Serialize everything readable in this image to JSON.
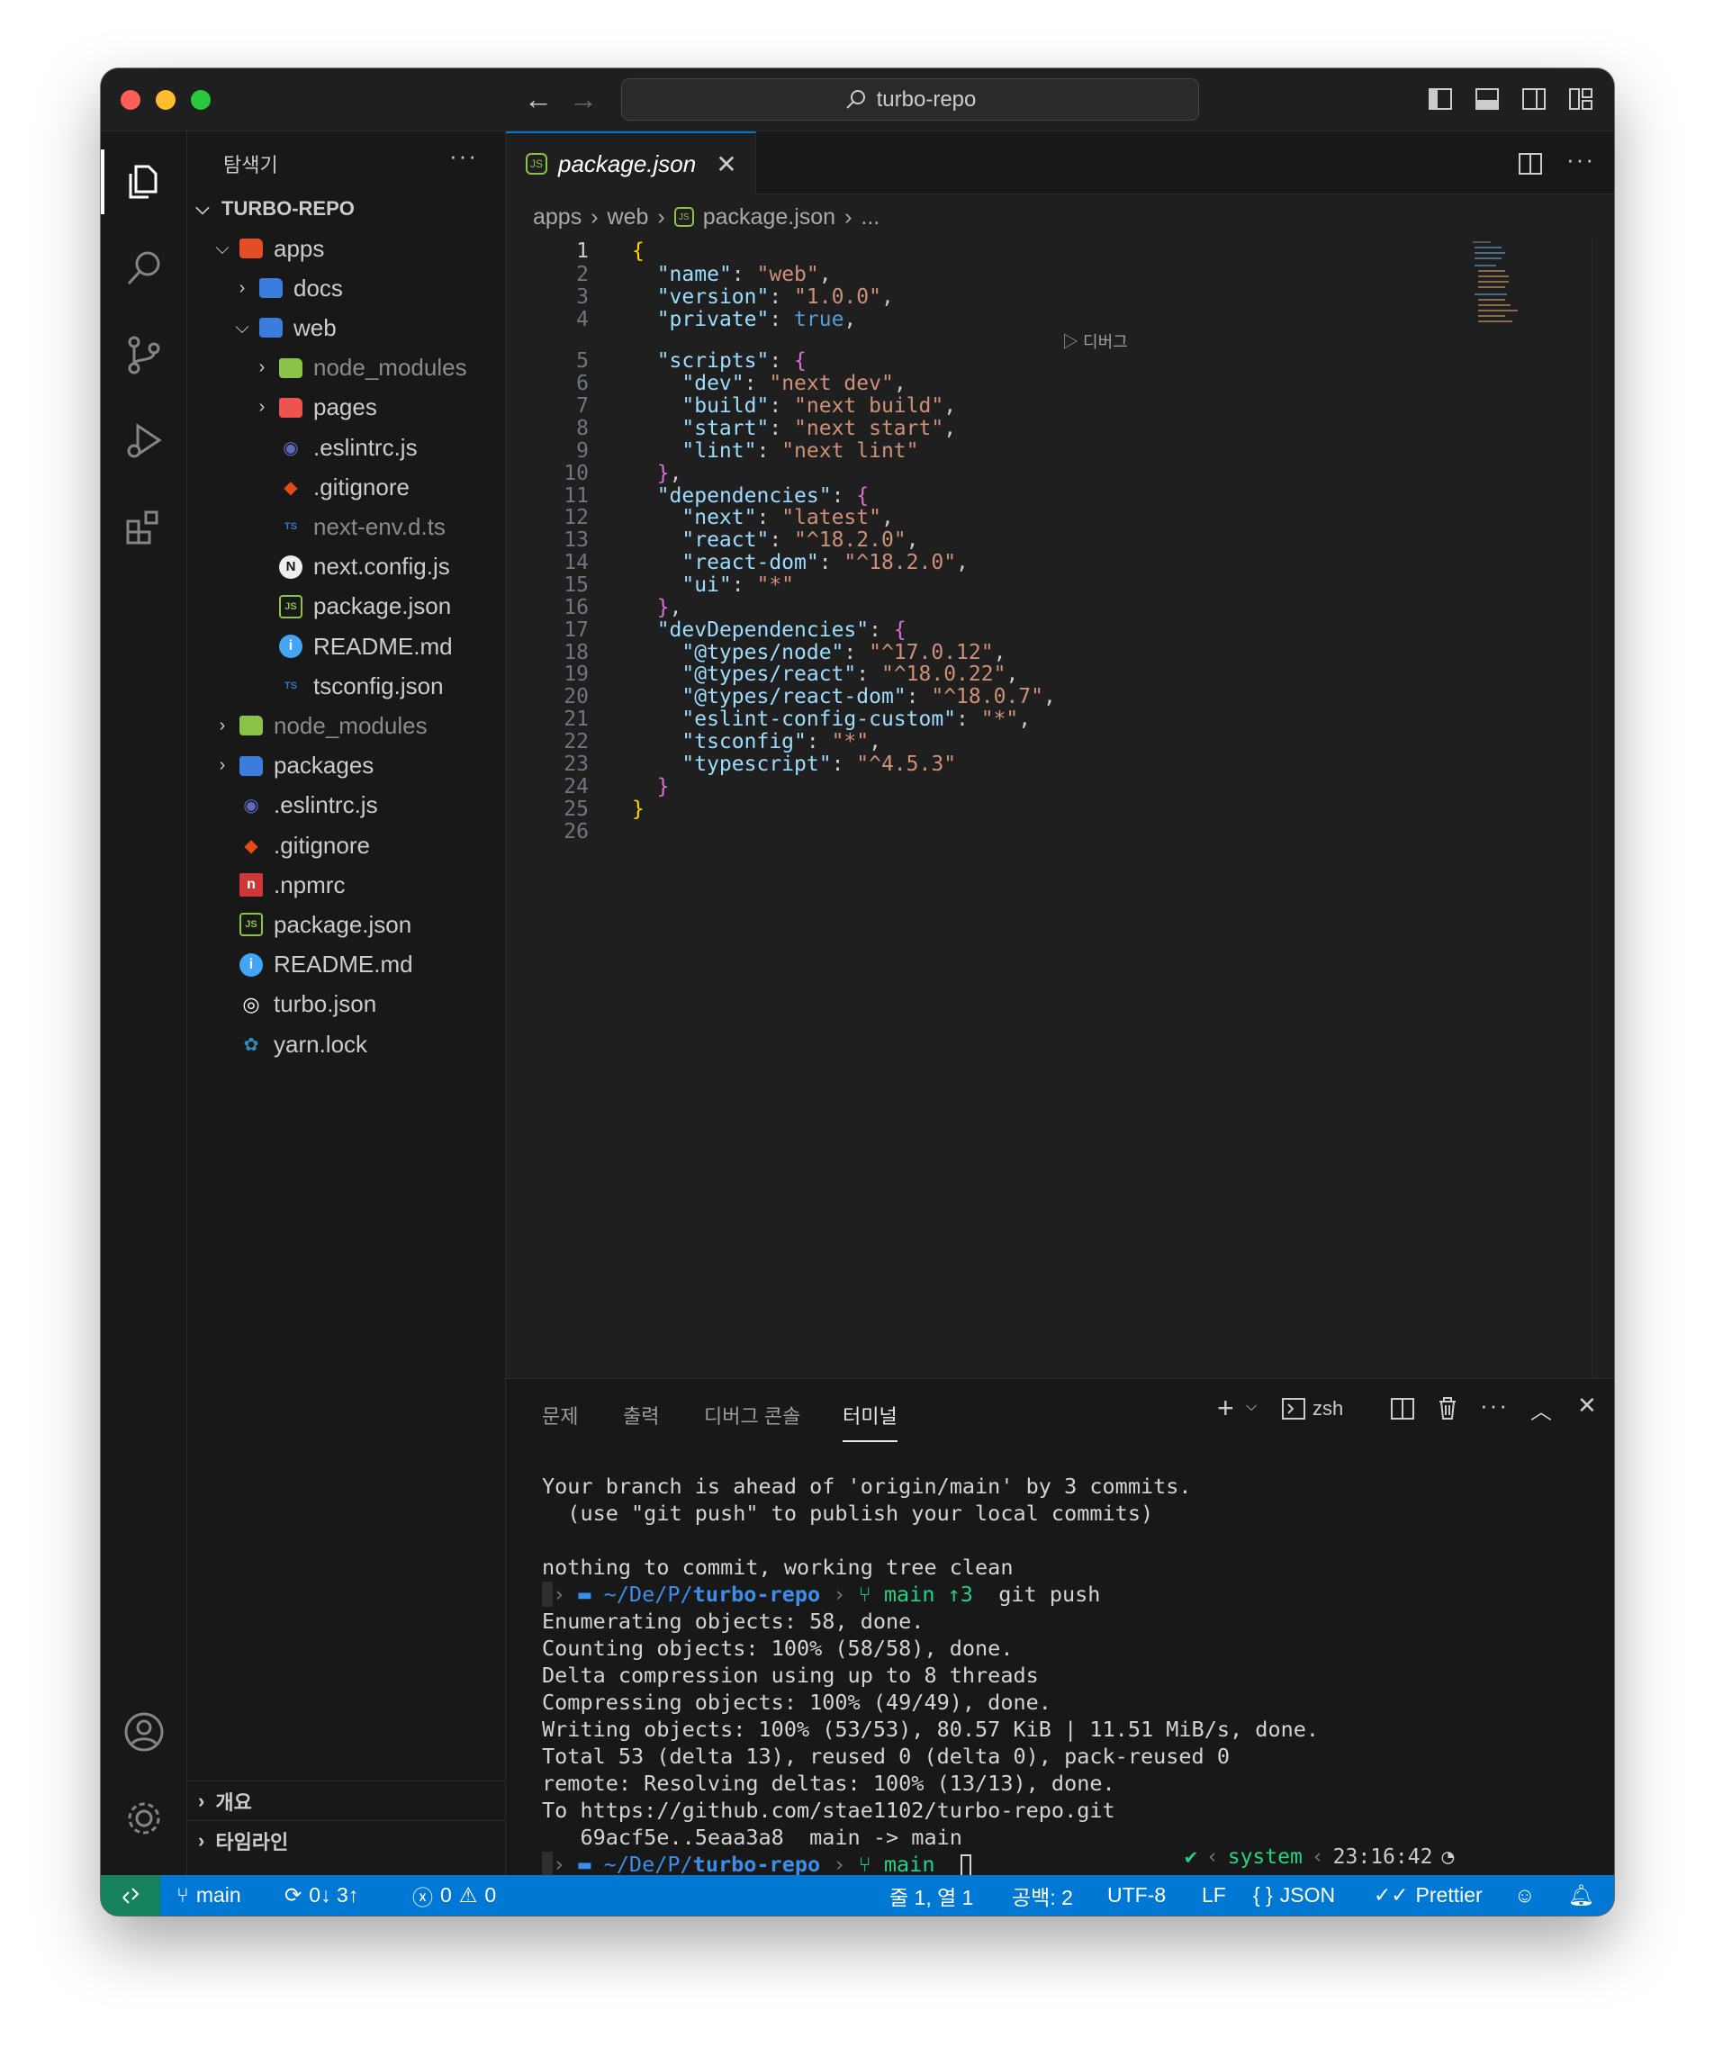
{
  "titlebar": {
    "search_text": "turbo-repo"
  },
  "sidebar": {
    "title": "탐색기",
    "more": "···",
    "root": "TURBO-REPO",
    "tree": [
      {
        "label": "apps",
        "depth": 1,
        "chev": "open",
        "icon": "folder-apps-icon",
        "color": "#e44d26",
        "dim": false
      },
      {
        "label": "docs",
        "depth": 2,
        "chev": "closed",
        "icon": "folder-docs-icon",
        "color": "#3b7ddd",
        "dim": false
      },
      {
        "label": "web",
        "depth": 2,
        "chev": "open",
        "icon": "folder-web-icon",
        "color": "#3b7ddd",
        "dim": false
      },
      {
        "label": "node_modules",
        "depth": 3,
        "chev": "closed",
        "icon": "folder-node-icon",
        "color": "#8bc34a",
        "dim": true
      },
      {
        "label": "pages",
        "depth": 3,
        "chev": "closed",
        "icon": "folder-pages-icon",
        "color": "#ef5350",
        "dim": false
      },
      {
        "label": ".eslintrc.js",
        "depth": 3,
        "chev": "",
        "icon": "eslint-icon",
        "color": "#5c6bc0",
        "dim": false
      },
      {
        "label": ".gitignore",
        "depth": 3,
        "chev": "",
        "icon": "git-icon",
        "color": "#e64a19",
        "dim": false
      },
      {
        "label": "next-env.d.ts",
        "depth": 3,
        "chev": "",
        "icon": "typescript-def-icon",
        "color": "#3178c6",
        "dim": true
      },
      {
        "label": "next.config.js",
        "depth": 3,
        "chev": "",
        "icon": "nextjs-icon",
        "color": "#eeeeee",
        "dim": false
      },
      {
        "label": "package.json",
        "depth": 3,
        "chev": "",
        "icon": "nodejs-icon",
        "color": "#8bc34a",
        "dim": false
      },
      {
        "label": "README.md",
        "depth": 3,
        "chev": "",
        "icon": "info-icon",
        "color": "#42a5f5",
        "dim": false
      },
      {
        "label": "tsconfig.json",
        "depth": 3,
        "chev": "",
        "icon": "tsconfig-icon",
        "color": "#3178c6",
        "dim": false
      },
      {
        "label": "node_modules",
        "depth": 1,
        "chev": "closed",
        "icon": "folder-node-icon",
        "color": "#8bc34a",
        "dim": true
      },
      {
        "label": "packages",
        "depth": 1,
        "chev": "closed",
        "icon": "folder-packages-icon",
        "color": "#3b7ddd",
        "dim": false
      },
      {
        "label": ".eslintrc.js",
        "depth": 1,
        "chev": "",
        "icon": "eslint-icon",
        "color": "#5c6bc0",
        "dim": false
      },
      {
        "label": ".gitignore",
        "depth": 1,
        "chev": "",
        "icon": "git-icon",
        "color": "#e64a19",
        "dim": false
      },
      {
        "label": ".npmrc",
        "depth": 1,
        "chev": "",
        "icon": "npm-icon",
        "color": "#cb3837",
        "dim": false
      },
      {
        "label": "package.json",
        "depth": 1,
        "chev": "",
        "icon": "nodejs-icon",
        "color": "#8bc34a",
        "dim": false
      },
      {
        "label": "README.md",
        "depth": 1,
        "chev": "",
        "icon": "info-icon",
        "color": "#42a5f5",
        "dim": false
      },
      {
        "label": "turbo.json",
        "depth": 1,
        "chev": "",
        "icon": "turbo-icon",
        "color": "#ffffff",
        "dim": false
      },
      {
        "label": "yarn.lock",
        "depth": 1,
        "chev": "",
        "icon": "yarn-icon",
        "color": "#2c8ebb",
        "dim": false
      }
    ],
    "sections": [
      "개요",
      "타임라인"
    ]
  },
  "editor": {
    "tab_label": "package.json",
    "close": "✕",
    "breadcrumb": [
      "apps",
      "web",
      "package.json",
      "..."
    ],
    "codelens": "디버그",
    "line_numbers": [
      "1",
      "2",
      "3",
      "4",
      "5",
      "6",
      "7",
      "8",
      "9",
      "10",
      "11",
      "12",
      "13",
      "14",
      "15",
      "16",
      "17",
      "18",
      "19",
      "20",
      "21",
      "22",
      "23",
      "24",
      "25",
      "26"
    ]
  },
  "panel": {
    "tabs": [
      "문제",
      "출력",
      "디버그 콘솔",
      "터미널"
    ],
    "shell": "zsh",
    "terminal": [
      "Your branch is ahead of 'origin/main' by 3 commits.",
      "  (use \"git push\" to publish your local commits)",
      "",
      "nothing to commit, working tree clean",
      "Enumerating objects: 58, done.",
      "Counting objects: 100% (58/58), done.",
      "Delta compression using up to 8 threads",
      "Compressing objects: 100% (49/49), done.",
      "Writing objects: 100% (53/53), 80.57 KiB | 11.51 MiB/s, done.",
      "Total 53 (delta 13), reused 0 (delta 0), pack-reused 0",
      "remote: Resolving deltas: 100% (13/13), done.",
      "To https://github.com/stae1102/turbo-repo.git",
      "   69acf5e..5eaa3a8  main -> main"
    ],
    "prompt": {
      "path_prefix": "~/De/P/",
      "path_repo": "turbo-repo",
      "branch": "main",
      "ahead": "↑3",
      "command": "git push"
    },
    "right_prompt": {
      "check": "✔",
      "env": "system",
      "time": "23:16:42"
    }
  },
  "status": {
    "branch": "main",
    "sync": "0↓ 3↑",
    "errors": "0",
    "warnings": "0",
    "position": "줄 1, 열 1",
    "spaces": "공백: 2",
    "encoding": "UTF-8",
    "eol": "LF",
    "language": "JSON",
    "formatter": "Prettier"
  }
}
